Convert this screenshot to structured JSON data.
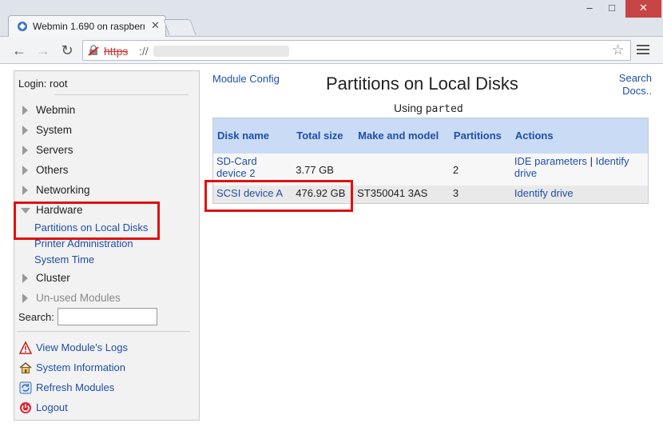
{
  "browser": {
    "tab_title": "Webmin 1.690 on raspberr",
    "url_scheme": "https",
    "url_rest": "://",
    "win_min": "–",
    "win_max": "□",
    "win_close": "✕",
    "tab_close": "✕"
  },
  "sidebar": {
    "login": "Login: root",
    "categories": [
      {
        "label": "Webmin"
      },
      {
        "label": "System"
      },
      {
        "label": "Servers"
      },
      {
        "label": "Others"
      },
      {
        "label": "Networking"
      },
      {
        "label": "Hardware"
      },
      {
        "label": "Cluster"
      },
      {
        "label": "Un-used Modules"
      }
    ],
    "hardware_modules": [
      {
        "label": "Partitions on Local Disks"
      },
      {
        "label": "Printer Administration"
      },
      {
        "label": "System Time"
      }
    ],
    "search_label": "Search:",
    "search_value": "",
    "links": [
      {
        "label": "View Module's Logs",
        "icon": "warning-icon"
      },
      {
        "label": "System Information",
        "icon": "home-icon"
      },
      {
        "label": "Refresh Modules",
        "icon": "refresh-icon"
      },
      {
        "label": "Logout",
        "icon": "power-icon"
      }
    ]
  },
  "main": {
    "module_config": "Module Config",
    "title": "Partitions on Local Disks",
    "search_docs_line1": "Search",
    "search_docs_line2": "Docs..",
    "using_prefix": "Using",
    "using_tool": "parted",
    "table": {
      "headers": [
        "Disk name",
        "Total size",
        "Make and model",
        "Partitions",
        "Actions"
      ],
      "rows": [
        {
          "disk": "SD-Card device 2",
          "size": "3.77 GB",
          "model": "",
          "partitions": "2",
          "action1": "IDE parameters",
          "sep": "|",
          "action2": "Identify drive"
        },
        {
          "disk": "SCSI device A",
          "size": "476.92 GB",
          "model": "ST350041 3AS",
          "partitions": "3",
          "action1": "Identify drive"
        }
      ]
    }
  },
  "colors": {
    "accent_link": "#1f4fa8",
    "header_bg": "#c9dbf5",
    "highlight": "#e01010"
  }
}
